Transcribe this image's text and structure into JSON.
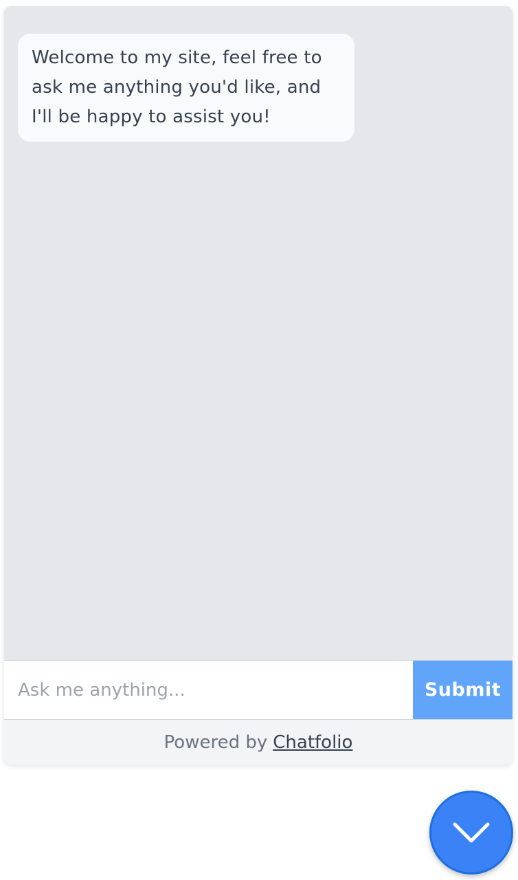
{
  "chat": {
    "welcome_message": "Welcome to my site, feel free to ask me anything you'd like, and I'll be happy to assist you!"
  },
  "input": {
    "value": "",
    "placeholder": "Ask me anything..."
  },
  "submit_label": "Submit",
  "footer": {
    "powered_by": "Powered by",
    "brand": "Chatfolio"
  },
  "toggle_icon": "chevron-down-icon",
  "colors": {
    "chat_background": "#e5e7eb",
    "bubble_background": "#f9fafb",
    "submit_background": "#60a5fa",
    "toggle_background": "#3b82f6",
    "footer_background": "#f3f4f6"
  }
}
